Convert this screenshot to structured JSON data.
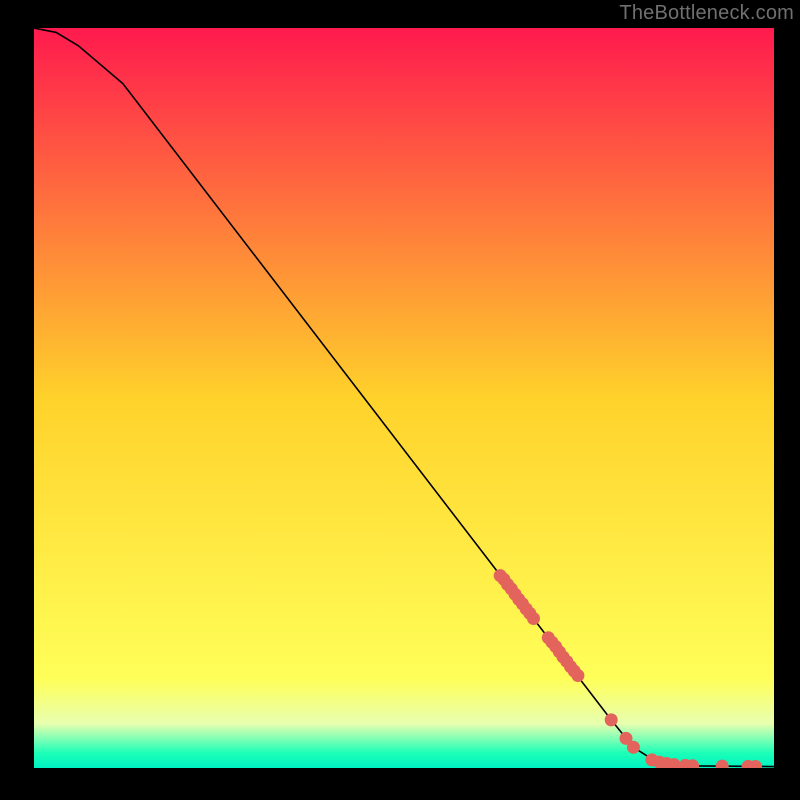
{
  "attribution": "TheBottleneck.com",
  "chart_data": {
    "type": "line",
    "title": "",
    "xlabel": "",
    "ylabel": "",
    "xlim": [
      0,
      100
    ],
    "ylim": [
      0,
      100
    ],
    "background_gradient": {
      "stops": [
        {
          "pct": 0,
          "color": "#ff1a4e"
        },
        {
          "pct": 50,
          "color": "#ffd22b"
        },
        {
          "pct": 88,
          "color": "#ffff59"
        },
        {
          "pct": 94,
          "color": "#e8ffb0"
        },
        {
          "pct": 98,
          "color": "#1bffb8"
        },
        {
          "pct": 100,
          "color": "#00f2c2"
        }
      ]
    },
    "curve": [
      {
        "x": 0.0,
        "y": 100.0
      },
      {
        "x": 3.0,
        "y": 99.4
      },
      {
        "x": 6.0,
        "y": 97.6
      },
      {
        "x": 12.0,
        "y": 92.5
      },
      {
        "x": 78.0,
        "y": 6.5
      },
      {
        "x": 81.0,
        "y": 2.8
      },
      {
        "x": 84.0,
        "y": 0.9
      },
      {
        "x": 87.0,
        "y": 0.3
      },
      {
        "x": 100.0,
        "y": 0.2
      }
    ],
    "series": [
      {
        "name": "highlight-points",
        "marker_color": "#e2645c",
        "x": [
          63.0,
          63.5,
          64.0,
          64.5,
          65.0,
          65.5,
          66.0,
          66.5,
          67.0,
          67.5,
          69.5,
          70.0,
          70.5,
          71.0,
          71.5,
          72.0,
          72.5,
          73.0,
          73.5,
          78.0,
          80.0,
          81.0,
          83.5,
          84.5,
          85.5,
          86.5,
          88.0,
          89.0,
          93.0,
          96.5,
          97.5
        ],
        "y": [
          26.0,
          25.5,
          24.8,
          24.2,
          23.5,
          22.8,
          22.2,
          21.5,
          20.9,
          20.2,
          17.6,
          17.0,
          16.4,
          15.7,
          15.0,
          14.4,
          13.7,
          13.1,
          12.5,
          6.5,
          4.0,
          2.8,
          1.1,
          0.8,
          0.6,
          0.45,
          0.35,
          0.3,
          0.25,
          0.22,
          0.2
        ]
      }
    ]
  }
}
